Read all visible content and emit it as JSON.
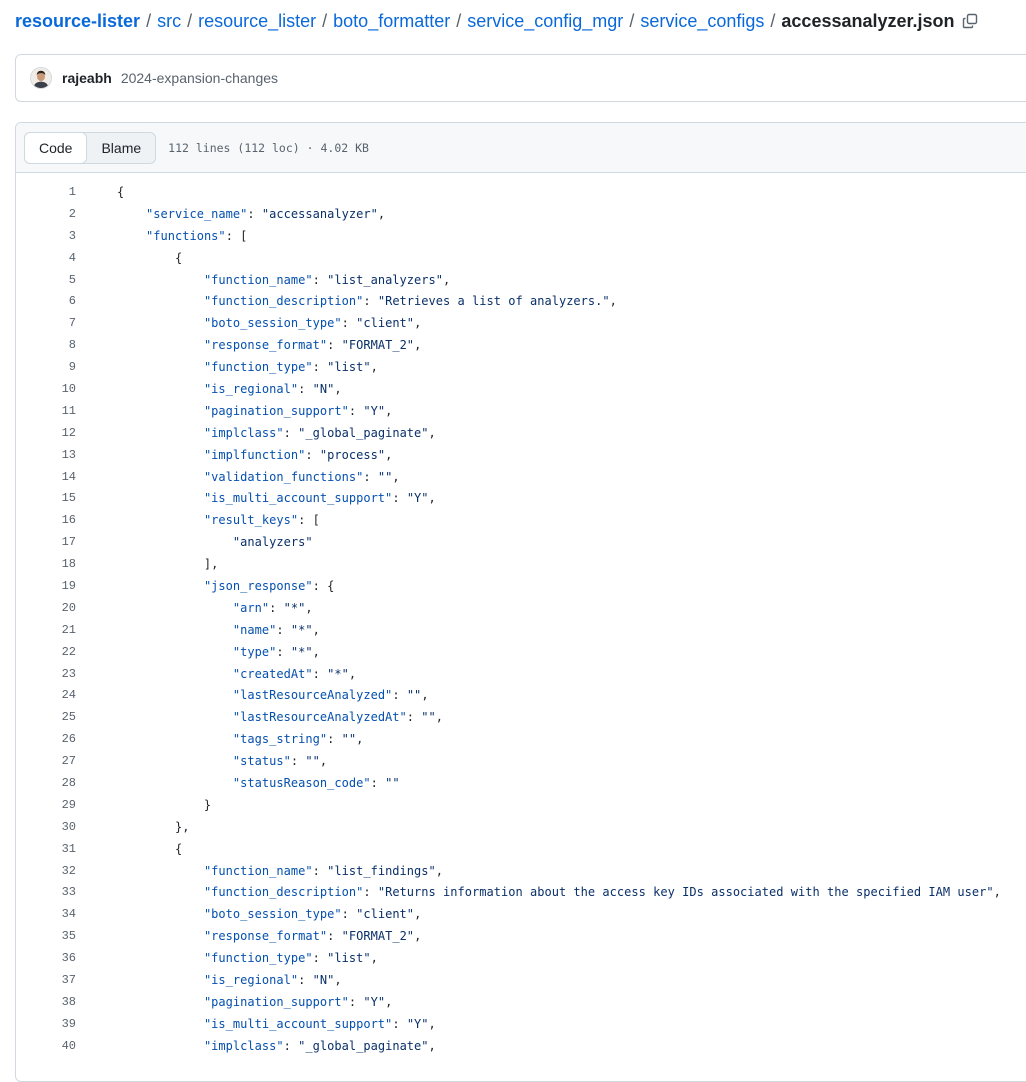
{
  "breadcrumb": {
    "items": [
      "resource-lister",
      "src",
      "resource_lister",
      "boto_formatter",
      "service_config_mgr",
      "service_configs"
    ],
    "separator": "/",
    "file": "accessanalyzer.json",
    "copy_icon": "copy-icon"
  },
  "commit": {
    "author": "rajeabh",
    "message": "2024-expansion-changes",
    "avatar_icon": "avatar"
  },
  "file_header": {
    "tabs": [
      "Code",
      "Blame"
    ],
    "active_tab": "Code",
    "meta": "112 lines (112 loc) · 4.02 KB"
  },
  "colors": {
    "link": "#0969da",
    "json_key": "#0550ae",
    "json_string": "#0a3069",
    "line_number": "#59636e"
  },
  "code": {
    "lines": [
      "{",
      "    \"service_name\": \"accessanalyzer\",",
      "    \"functions\": [",
      "        {",
      "            \"function_name\": \"list_analyzers\",",
      "            \"function_description\": \"Retrieves a list of analyzers.\",",
      "            \"boto_session_type\": \"client\",",
      "            \"response_format\": \"FORMAT_2\",",
      "            \"function_type\": \"list\",",
      "            \"is_regional\": \"N\",",
      "            \"pagination_support\": \"Y\",",
      "            \"implclass\": \"_global_paginate\",",
      "            \"implfunction\": \"process\",",
      "            \"validation_functions\": \"\",",
      "            \"is_multi_account_support\": \"Y\",",
      "            \"result_keys\": [",
      "                \"analyzers\"",
      "            ],",
      "            \"json_response\": {",
      "                \"arn\": \"*\",",
      "                \"name\": \"*\",",
      "                \"type\": \"*\",",
      "                \"createdAt\": \"*\",",
      "                \"lastResourceAnalyzed\": \"\",",
      "                \"lastResourceAnalyzedAt\": \"\",",
      "                \"tags_string\": \"\",",
      "                \"status\": \"\",",
      "                \"statusReason_code\": \"\"",
      "            }",
      "        },",
      "        {",
      "            \"function_name\": \"list_findings\",",
      "            \"function_description\": \"Returns information about the access key IDs associated with the specified IAM user\",",
      "            \"boto_session_type\": \"client\",",
      "            \"response_format\": \"FORMAT_2\",",
      "            \"function_type\": \"list\",",
      "            \"is_regional\": \"N\",",
      "            \"pagination_support\": \"Y\",",
      "            \"is_multi_account_support\": \"Y\",",
      "            \"implclass\": \"_global_paginate\","
    ]
  }
}
